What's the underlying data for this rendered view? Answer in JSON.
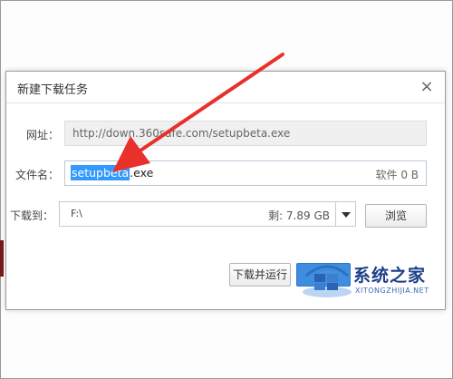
{
  "dialog": {
    "title": "新建下载任务",
    "close_icon": "close-icon",
    "url_label": "网址：",
    "url_value": "http://down.360safe.com/setupbeta.exe",
    "filename_label": "文件名：",
    "filename_selected": "setupbeta",
    "filename_ext": ".exe",
    "file_size": "软件 0 B",
    "saveto_label": "下载到：",
    "saveto_value": "F:\\",
    "free_space": "剩: 7.89 GB",
    "browse_label": "浏览",
    "download_run_label": "下载并运行"
  },
  "watermark": {
    "name": "系统之家",
    "site": "XITONGZHIJIA.NET",
    "icon": "windows-logo-icon"
  },
  "annotation": {
    "icon": "red-arrow-icon",
    "color": "#e8312b"
  }
}
